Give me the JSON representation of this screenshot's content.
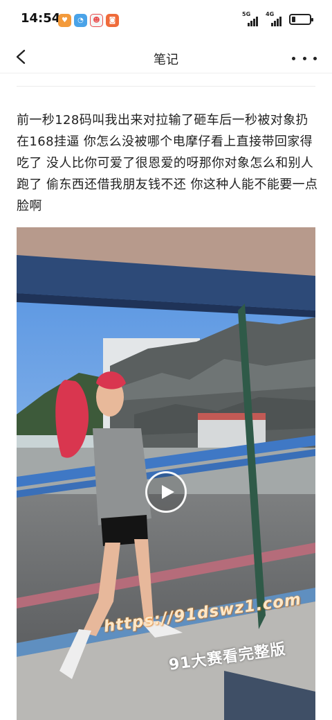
{
  "status_bar": {
    "time": "14:54",
    "app_icons": [
      {
        "name": "heart-app-icon",
        "color": "#f39a3b",
        "glyph": "♥"
      },
      {
        "name": "chat-app-icon",
        "color": "#4aa3e8",
        "glyph": "◔"
      },
      {
        "name": "game-app-icon",
        "color": "#e84a4a",
        "glyph": "☻"
      },
      {
        "name": "shop-app-icon",
        "color": "#ef6b3a",
        "glyph": "◙"
      }
    ],
    "network1": "5G",
    "network2": "4G",
    "battery_level": 0.2
  },
  "nav": {
    "title": "笔记",
    "back_icon": "chevron-left-icon",
    "more_icon": "more-horizontal-icon"
  },
  "post": {
    "text": "前一秒128码叫我出来对拉输了砸车后一秒被对象扔在168挂逼 你怎么没被哪个电摩仔看上直接带回家得吃了 没人比你可爱了很恩爱的呀那你对象怎么和别人跑了 偷东西还借我朋友钱不还 你这种人能不能要一点脸啊"
  },
  "video": {
    "play_icon": "play-icon"
  },
  "watermark": {
    "url": "https://91dswz1.com",
    "caption": "91大赛看完整版"
  }
}
